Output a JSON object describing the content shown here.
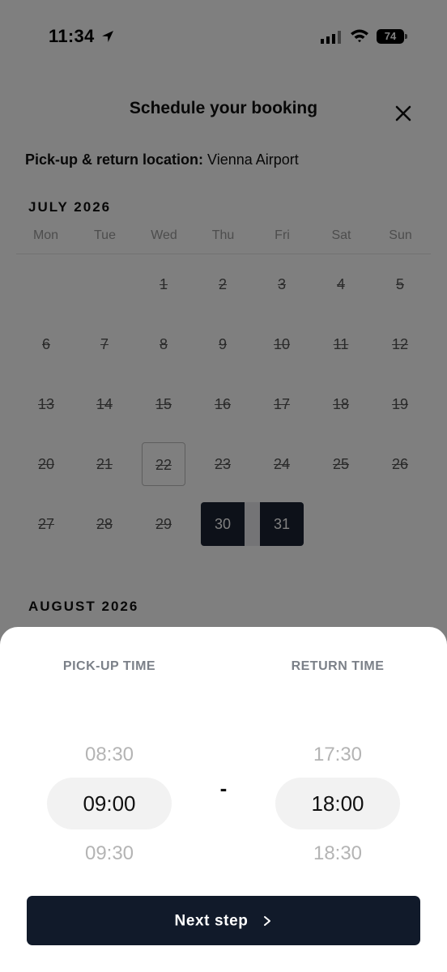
{
  "status_bar": {
    "time": "11:34",
    "battery": "74"
  },
  "header": {
    "title": "Schedule your booking",
    "close_icon": "close-icon"
  },
  "location": {
    "label": "Pick-up & return location:",
    "value": " Vienna Airport"
  },
  "calendar": {
    "month_1": "JULY 2026",
    "month_2": "AUGUST 2026",
    "weekdays": [
      "Mon",
      "Tue",
      "Wed",
      "Thu",
      "Fri",
      "Sat",
      "Sun"
    ],
    "days": [
      "1",
      "2",
      "3",
      "4",
      "5",
      "6",
      "7",
      "8",
      "9",
      "10",
      "11",
      "12",
      "13",
      "14",
      "15",
      "16",
      "17",
      "18",
      "19",
      "20",
      "21",
      "22",
      "23",
      "24",
      "25",
      "26",
      "27",
      "28",
      "29",
      "30",
      "31"
    ],
    "today": "22",
    "selected_start": "30",
    "selected_end": "31",
    "colors": {
      "selected_bg": "#1a2233",
      "disabled_text": "#555555"
    }
  },
  "time_picker": {
    "pickup_label": "PICK-UP TIME",
    "return_label": "RETURN TIME",
    "pickup_prev": "08:30",
    "pickup_current": "09:00",
    "pickup_next": "09:30",
    "separator": "-",
    "return_prev": "17:30",
    "return_current": "18:00",
    "return_next": "18:30"
  },
  "footer": {
    "next_label": "Next step",
    "button_color": "#111a2a"
  }
}
